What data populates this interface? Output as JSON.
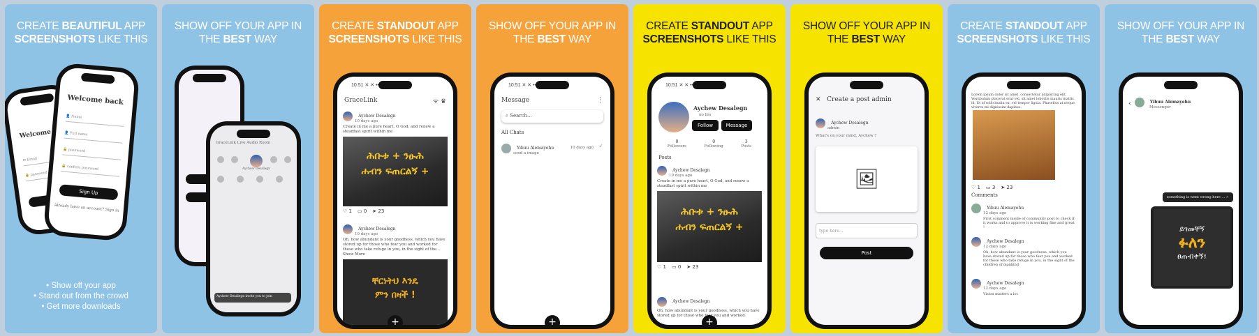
{
  "panels": [
    {
      "headline_pre": "CREATE ",
      "headline_bold": "BEAUTIFUL",
      "headline_post": " APP",
      "headline2_bold": "SCREENSHOTS",
      "headline2_post": " LIKE THIS",
      "login": {
        "title": "Welcome back",
        "title_back": "Welcome back",
        "signup": "Sign Up",
        "links": "Already have an account?  Sign in"
      },
      "bullets": [
        "• Show off your app",
        "• Stand out from the crowd",
        "• Get more downloads"
      ]
    },
    {
      "headline_pre": "SHOW OFF YOUR APP IN",
      "headline2_pre": "THE ",
      "headline2_bold": "BEST",
      "headline2_post": " WAY",
      "audio": {
        "title": "GraceLink Live Audio Room",
        "host": "Aychew Desalegn",
        "toast": "Aychew Desalegn  invite you to join"
      }
    },
    {
      "headline_pre": "CREATE ",
      "headline_bold": "STANDOUT",
      "headline_post": " APP",
      "headline2_bold": "SCREENSHOTS",
      "headline2_post": " LIKE THIS",
      "feed": {
        "app_title": "GraceLink",
        "author": "Aychew Desalegn",
        "time": "10 days ago",
        "post1": "Create in me a pure heart, O God, and renew a steadfast spirit within me",
        "post2": "Oh, how abundant is your goodness, which you have stored up for those who fear you and worked for those who take refuge in you, in the sight of the... Show More",
        "img_line1": "ሕቡቱ + ንፁሕ",
        "img_line2": "ሐብን ፍጠርልኝ +",
        "img2_line1": "ቸርነትህ እንዴ",
        "img2_line2": "ምን በዛች !",
        "likes": "1",
        "comments": "0",
        "shares": "23"
      }
    },
    {
      "headline_pre": "SHOW OFF YOUR APP IN",
      "headline2_pre": "THE ",
      "headline2_bold": "BEST",
      "headline2_post": " WAY",
      "messages": {
        "title": "Message",
        "search": "Search...",
        "section": "All Chats",
        "contact": "Yibuu Alemayehu",
        "preview": "send a image",
        "time": "10 days ago"
      }
    },
    {
      "headline_pre": "CREATE ",
      "headline_bold": "STANDOUT",
      "headline_post": " APP",
      "headline2_bold": "SCREENSHOTS",
      "headline2_post": " LIKE THIS",
      "profile": {
        "name": "Aychew Desalegn",
        "bio": "no bio",
        "follow": "Follow",
        "message": "Message",
        "stats": [
          {
            "n": "0",
            "l": "Followers"
          },
          {
            "n": "0",
            "l": "Following"
          },
          {
            "n": "3",
            "l": "Posts"
          }
        ],
        "posts_label": "Posts",
        "author": "Aychew Desalegn",
        "time": "10 days ago",
        "post1": "Create in me a pure heart, O God, and renew a steadfast spirit within me",
        "post2": "Oh, how abundant is your goodness, which you have stored up for those who fear you and worked",
        "img_line1": "ሕቡቱ + ንፁሕ",
        "img_line2": "ሐብን ፍጠርልኝ +",
        "likes": "1",
        "comments": "0",
        "shares": "23"
      }
    },
    {
      "headline_pre": "SHOW OFF YOUR APP IN",
      "headline2_pre": "THE ",
      "headline2_bold": "BEST",
      "headline2_post": " WAY",
      "create": {
        "title": "Create a post admin",
        "user": "Aychew Desalegn",
        "role": "admin",
        "prompt": "What's on your mind, Aychew ?",
        "input": "type here...",
        "post": "Post"
      }
    },
    {
      "headline_pre": "CREATE ",
      "headline_bold": "STANDOUT",
      "headline_post": " APP",
      "headline2_bold": "SCREENSHOTS",
      "headline2_post": " LIKE THIS",
      "comments": {
        "intro": "Lorem ipsum dolor sit amet, consectetur adipiscing elit. Vestibulum placerat erat vel, sit amet lobortis mauris mattis id. Et id sollicitudin ex, vel tempor ligula. Phasellus at neque viverra mi dignissim dapibus.",
        "likes": "1",
        "comments": "3",
        "shares": "23",
        "label": "Comments",
        "items": [
          {
            "name": "Yibuu Alemayehu",
            "time": "12 days ago",
            "text": "First comment inside of community post to check if it works and to approve it is working fine and great !"
          },
          {
            "name": "Aychew Desalegn",
            "time": "12 days ago",
            "text": "Oh, how abundant is your goodness, which you have stored up for those who fear you and worked for those who take refuge in you, in the sight of the children of mankind"
          },
          {
            "name": "Aychew Desalegn",
            "time": "12 days ago",
            "text": "Vision matters a lot"
          }
        ]
      }
    },
    {
      "headline_pre": "SHOW OFF YOUR APP IN",
      "headline2_pre": "THE ",
      "headline2_bold": "BEST",
      "headline2_post": " WAY",
      "chat": {
        "name": "Yibuu Alemayehu",
        "status": "Messenger",
        "bubble": "something is went wrong here ...",
        "img_line1": "ይገመቸኝ",
        "img_line2": "ፉለን",
        "img_line3": "ፀጠብቀኝ፤"
      }
    }
  ]
}
